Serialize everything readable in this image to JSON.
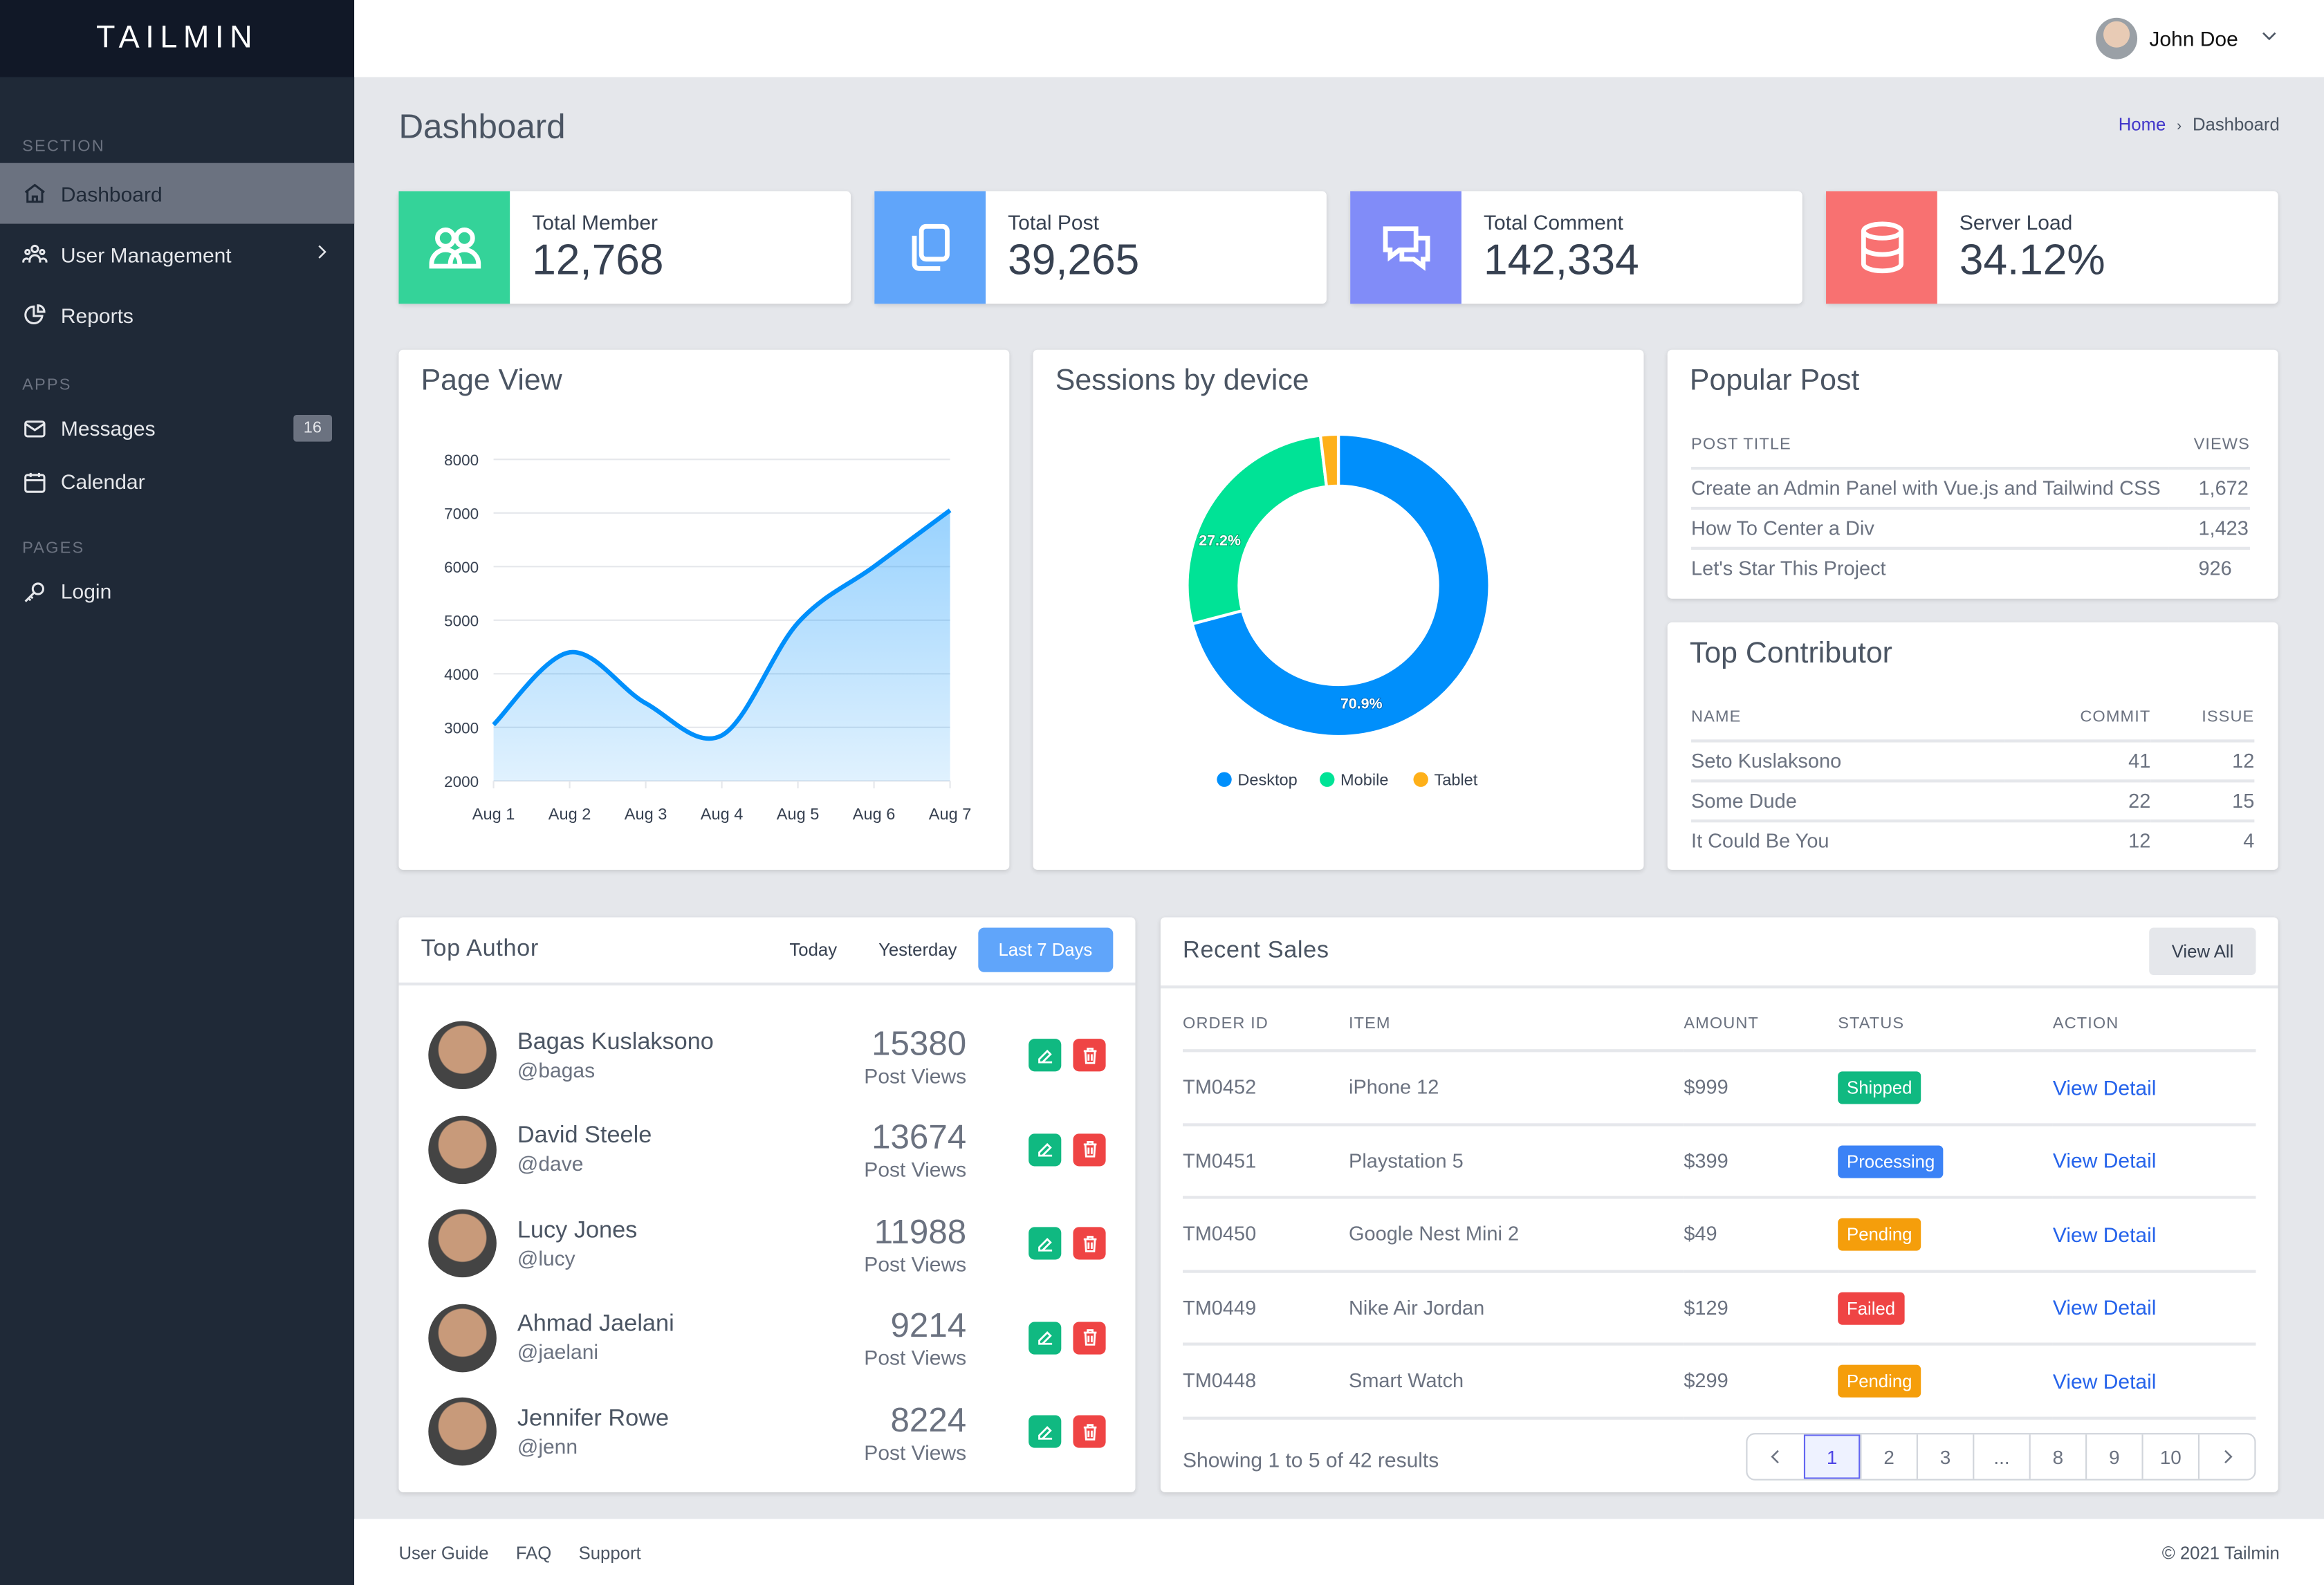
{
  "brand": "TAILMIN",
  "sidebar": {
    "sections": [
      "SECTION",
      "APPS",
      "PAGES"
    ],
    "items": [
      {
        "label": "Dashboard",
        "icon": "home-icon",
        "active": true
      },
      {
        "label": "User Management",
        "icon": "users-icon",
        "chevron": true
      },
      {
        "label": "Reports",
        "icon": "chart-pie-icon"
      },
      {
        "label": "Messages",
        "icon": "mail-icon",
        "badge": "16"
      },
      {
        "label": "Calendar",
        "icon": "calendar-icon"
      },
      {
        "label": "Login",
        "icon": "key-icon"
      }
    ]
  },
  "header": {
    "user": "John Doe"
  },
  "page": {
    "title": "Dashboard",
    "breadcrumb": {
      "home": "Home",
      "sep": "›",
      "current": "Dashboard"
    }
  },
  "stats": [
    {
      "label": "Total Member",
      "value": "12,768",
      "color": "#34d399",
      "icon": "users-icon"
    },
    {
      "label": "Total Post",
      "value": "39,265",
      "color": "#60a5fa",
      "icon": "documents-icon"
    },
    {
      "label": "Total Comment",
      "value": "142,334",
      "color": "#818cf8",
      "icon": "chat-icon"
    },
    {
      "label": "Server Load",
      "value": "34.12%",
      "color": "#f87171",
      "icon": "database-icon"
    }
  ],
  "pageview": {
    "title": "Page View"
  },
  "sessions": {
    "title": "Sessions by device"
  },
  "chart_data": [
    {
      "type": "area",
      "title": "Page View",
      "x": [
        "Aug 1",
        "Aug 2",
        "Aug 3",
        "Aug 4",
        "Aug 5",
        "Aug 6",
        "Aug 7"
      ],
      "series": [
        {
          "name": "Page View",
          "values": [
            3050,
            4400,
            3450,
            2850,
            4950,
            6000,
            7050
          ]
        }
      ],
      "yticks": [
        2000,
        3000,
        4000,
        5000,
        6000,
        7000,
        8000
      ],
      "ylim": [
        2000,
        8000
      ],
      "grid": true,
      "color": "#008ffb"
    },
    {
      "type": "pie",
      "title": "Sessions by device",
      "categories": [
        "Desktop",
        "Mobile",
        "Tablet"
      ],
      "values": [
        70.9,
        27.2,
        1.9
      ],
      "labels": [
        "70.9%",
        "27.2%",
        ""
      ],
      "colors": [
        "#008ffb",
        "#00e396",
        "#feb019"
      ],
      "legend": "bottom",
      "donut": true
    }
  ],
  "popular": {
    "title": "Popular Post",
    "cols": [
      "POST TITLE",
      "VIEWS"
    ],
    "rows": [
      [
        "Create an Admin Panel with Vue.js and Tailwind CSS",
        "1,672"
      ],
      [
        "How To Center a Div",
        "1,423"
      ],
      [
        "Let's Star This Project",
        "926"
      ]
    ]
  },
  "contrib": {
    "title": "Top Contributor",
    "cols": [
      "NAME",
      "COMMIT",
      "ISSUE"
    ],
    "rows": [
      [
        "Seto Kuslaksono",
        "41",
        "12"
      ],
      [
        "Some Dude",
        "22",
        "15"
      ],
      [
        "It Could Be You",
        "12",
        "4"
      ]
    ]
  },
  "authors": {
    "title": "Top Author",
    "tabs": [
      "Today",
      "Yesterday",
      "Last 7 Days"
    ],
    "active_tab": 2,
    "metric": "Post Views",
    "list": [
      {
        "name": "Bagas Kuslaksono",
        "handle": "@bagas",
        "views": "15380"
      },
      {
        "name": "David Steele",
        "handle": "@dave",
        "views": "13674"
      },
      {
        "name": "Lucy Jones",
        "handle": "@lucy",
        "views": "11988"
      },
      {
        "name": "Ahmad Jaelani",
        "handle": "@jaelani",
        "views": "9214"
      },
      {
        "name": "Jennifer Rowe",
        "handle": "@jenn",
        "views": "8224"
      }
    ]
  },
  "sales": {
    "title": "Recent Sales",
    "view_all": "View All",
    "cols": [
      "ORDER ID",
      "ITEM",
      "AMOUNT",
      "STATUS",
      "ACTION"
    ],
    "rows": [
      {
        "id": "TM0452",
        "item": "iPhone 12",
        "amount": "$999",
        "status": "Shipped",
        "color": "#10b981",
        "action": "View Detail"
      },
      {
        "id": "TM0451",
        "item": "Playstation 5",
        "amount": "$399",
        "status": "Processing",
        "color": "#3b82f6",
        "action": "View Detail"
      },
      {
        "id": "TM0450",
        "item": "Google Nest Mini 2",
        "amount": "$49",
        "status": "Pending",
        "color": "#f59e0b",
        "action": "View Detail"
      },
      {
        "id": "TM0449",
        "item": "Nike Air Jordan",
        "amount": "$129",
        "status": "Failed",
        "color": "#ef4444",
        "action": "View Detail"
      },
      {
        "id": "TM0448",
        "item": "Smart Watch",
        "amount": "$299",
        "status": "Pending",
        "color": "#f59e0b",
        "action": "View Detail"
      }
    ],
    "summary": "Showing 1 to 5 of 42 results",
    "pages": [
      "1",
      "2",
      "3",
      "...",
      "8",
      "9",
      "10"
    ],
    "current_page": "1"
  },
  "footer": {
    "links": [
      "User Guide",
      "FAQ",
      "Support"
    ],
    "copyright": "© 2021 Tailmin"
  }
}
